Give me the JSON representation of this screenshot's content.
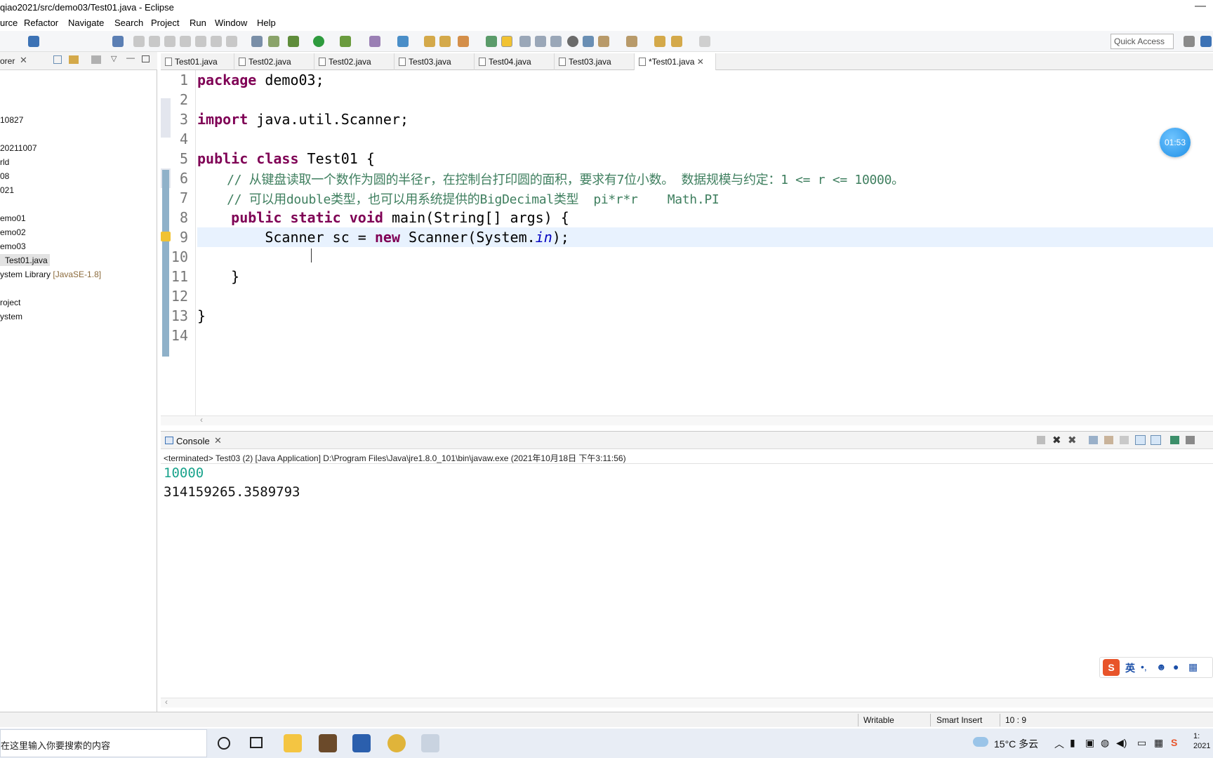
{
  "window": {
    "title": "qiao2021/src/demo03/Test01.java - Eclipse",
    "minimize_glyph": "—"
  },
  "menu": [
    "urce",
    "Refactor",
    "Navigate",
    "Search",
    "Project",
    "Run",
    "Window",
    "Help"
  ],
  "toolbar": {
    "quick_access_placeholder": "Quick Access"
  },
  "explorer": {
    "title": "orer",
    "items": [
      {
        "label": "10827"
      },
      {
        "label": "20211007"
      },
      {
        "label": "rld"
      },
      {
        "label": "08"
      },
      {
        "label": "021"
      },
      {
        "label": "emo01"
      },
      {
        "label": "emo02"
      },
      {
        "label": "emo03"
      },
      {
        "label": "Test01.java"
      },
      {
        "label": "ystem Library",
        "suffix": "[JavaSE-1.8]"
      },
      {
        "label": "roject"
      },
      {
        "label": "ystem"
      }
    ]
  },
  "tabs": [
    {
      "label": "Test01.java"
    },
    {
      "label": "Test02.java"
    },
    {
      "label": "Test02.java"
    },
    {
      "label": "Test03.java"
    },
    {
      "label": "Test04.java"
    },
    {
      "label": "Test03.java"
    },
    {
      "label": "*Test01.java",
      "active": true
    }
  ],
  "editor": {
    "line_numbers": [
      "1",
      "2",
      "3",
      "4",
      "5",
      "6",
      "7",
      "8",
      "9",
      "10",
      "11",
      "12",
      "13",
      "14"
    ],
    "lines": [
      {
        "kw": "package",
        "rest": " demo03;"
      },
      {
        "rest": ""
      },
      {
        "kw": "import",
        "rest": " java.util.Scanner;"
      },
      {
        "rest": ""
      },
      {
        "kw": "public class",
        "rest": " Test01 {"
      },
      {
        "comment": "    // 从键盘读取一个数作为圆的半径r，在控制台打印圆的面积，要求有7位小数。 数据规模与约定：1 <= r <= 10000。"
      },
      {
        "comment": "    // 可以用double类型，也可以用系统提供的BigDecimal类型  pi*r*r    Math.PI"
      },
      {
        "indent": "    ",
        "kw": "public static void",
        "rest": " main(String[] args) {"
      },
      {
        "indent": "        ",
        "pre": "Scanner sc = ",
        "kw": "new",
        "rest": " Scanner(System.",
        "italic": "in",
        "post": ");"
      },
      {
        "rest": ""
      },
      {
        "rest": "    }"
      },
      {
        "rest": ""
      },
      {
        "rest": "}"
      },
      {
        "rest": ""
      }
    ]
  },
  "console": {
    "title": "Console",
    "status": "<terminated> Test03 (2) [Java Application] D:\\Program Files\\Java\\jre1.8.0_101\\bin\\javaw.exe (2021年10月18日 下午3:11:56)",
    "input_line": "10000",
    "output_line": "314159265.3589793"
  },
  "statusbar": {
    "writable": "Writable",
    "insert_mode": "Smart Insert",
    "position": "10 : 9"
  },
  "taskbar": {
    "search_text": "在这里输入你要搜索的内容",
    "weather": "15°C 多云",
    "clock_partial": "1: 2021"
  },
  "overlay": {
    "timer": "01:53",
    "ime_lang": "英"
  },
  "colors": {
    "keyword": "#7f0055",
    "comment": "#3f7f5f",
    "console_input": "#1aa38c"
  }
}
